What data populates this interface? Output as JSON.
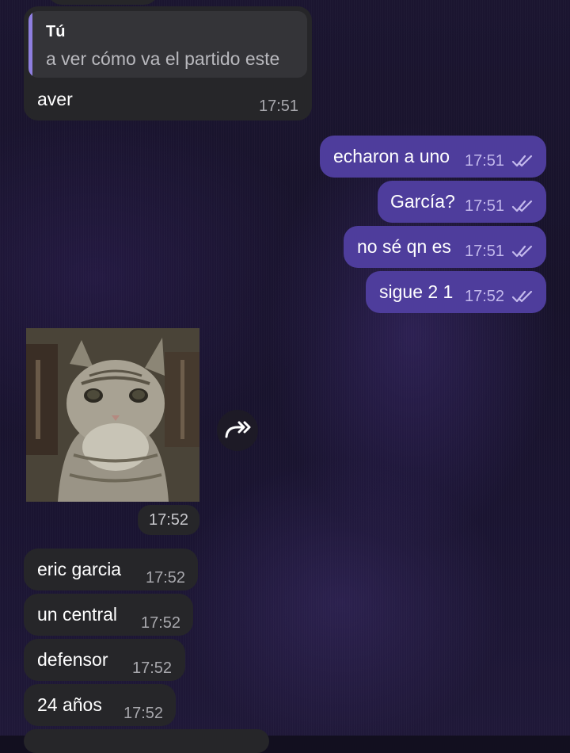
{
  "messages": [
    {
      "id": "m1",
      "direction": "in",
      "reply_to": {
        "author": "Tú",
        "text": "a ver cómo va el partido este"
      },
      "text": "aver",
      "time": "17:51"
    },
    {
      "id": "m2",
      "direction": "out",
      "text": "echaron a uno",
      "time": "17:51",
      "status": "read"
    },
    {
      "id": "m3",
      "direction": "out",
      "text": "García?",
      "time": "17:51",
      "status": "read"
    },
    {
      "id": "m4",
      "direction": "out",
      "text": "no sé qn es",
      "time": "17:51",
      "status": "read"
    },
    {
      "id": "m5",
      "direction": "out",
      "text": "sigue 2 1",
      "time": "17:52",
      "status": "read"
    },
    {
      "id": "m6",
      "direction": "in",
      "type": "photo",
      "photo_description": "tabby cat",
      "time": "17:52"
    },
    {
      "id": "m7",
      "direction": "in",
      "text": "eric garcia",
      "time": "17:52"
    },
    {
      "id": "m8",
      "direction": "in",
      "text": "un central",
      "time": "17:52"
    },
    {
      "id": "m9",
      "direction": "in",
      "text": "defensor",
      "time": "17:52"
    },
    {
      "id": "m10",
      "direction": "in",
      "text": "24 años",
      "time": "17:52"
    }
  ],
  "icons": {
    "read_status": "double-check-icon",
    "forward": "forward-icon"
  },
  "colors": {
    "incoming_bubble": "#262629",
    "outgoing_bubble": "#4e3d9c",
    "reply_accent": "#8f7fe0",
    "background": "#17122a"
  }
}
